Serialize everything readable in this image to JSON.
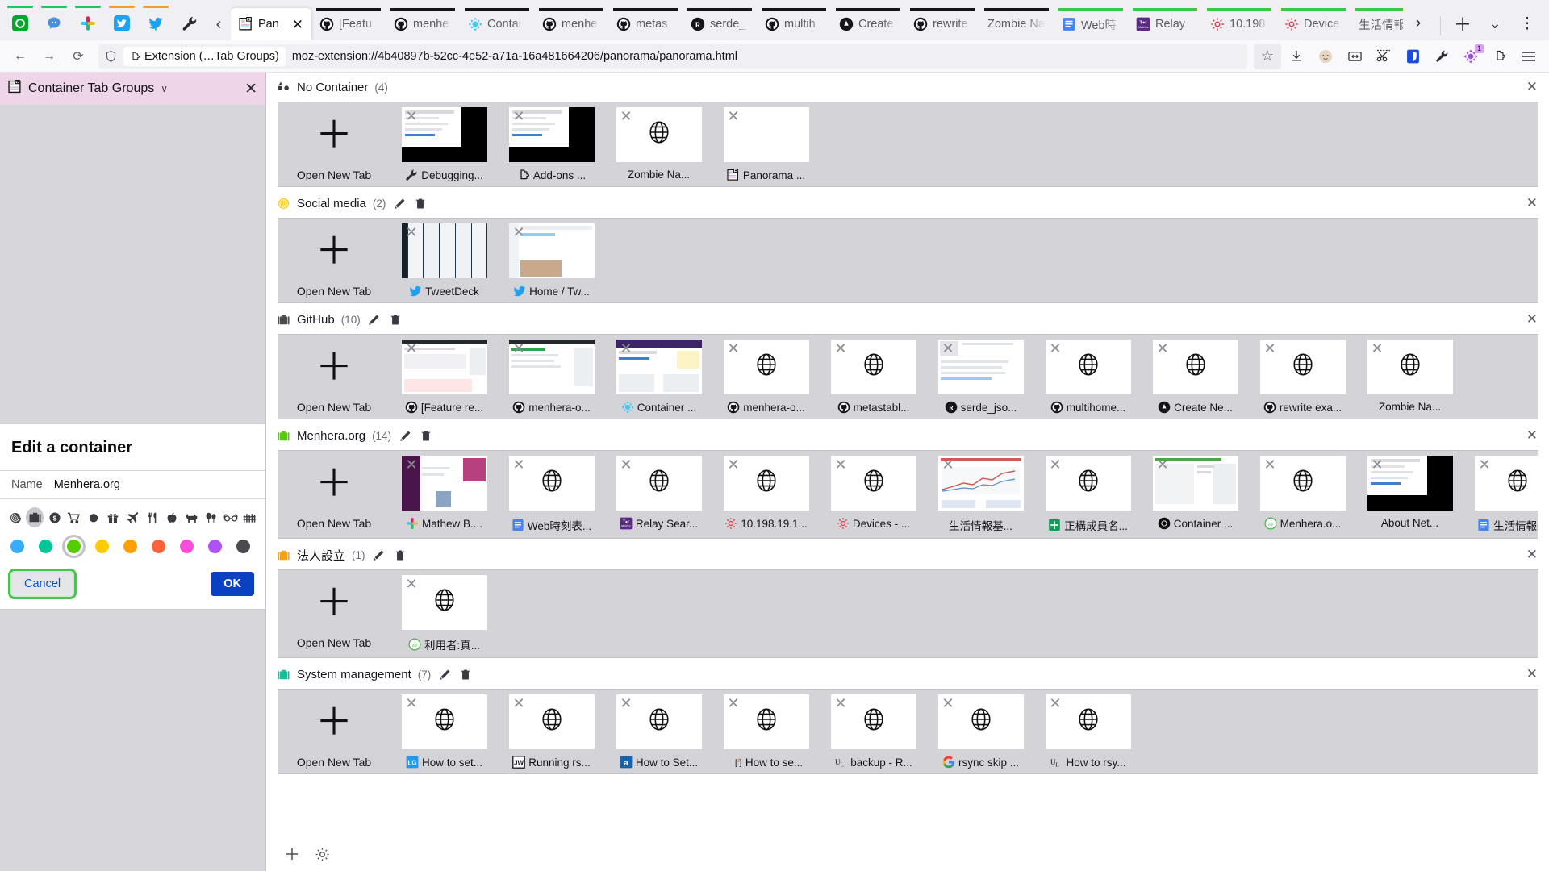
{
  "browser": {
    "pinned_tabs": [
      {
        "name": "evernote",
        "color": "#00a82d",
        "glyph": "◔",
        "accent": "#1fc36b"
      },
      {
        "name": "chat",
        "color": "#4a90d9",
        "glyph": "●",
        "accent": "#1fc36b"
      },
      {
        "name": "slack",
        "color": "#e01e5a",
        "glyph": "✵",
        "accent": "#1fc36b"
      },
      {
        "name": "twitter",
        "color": "#1da1f2",
        "glyph": "✉",
        "accent": "#f0a030"
      },
      {
        "name": "tweetdeck",
        "color": "#1da1f2",
        "glyph": "✈",
        "accent": "#f0a030"
      },
      {
        "name": "wrench",
        "color": "#3a3a42",
        "glyph": "🔧",
        "accent": ""
      }
    ],
    "scroll_left_label": "‹",
    "scroll_right_label": "›",
    "tabs": [
      {
        "title": "Panorama",
        "short": "Pan",
        "favicon": "panorama-icon",
        "active": true,
        "accent": ""
      },
      {
        "title": "[Feature request]",
        "short": "[Featu",
        "favicon": "github-icon",
        "active": false,
        "accent": "#15141a"
      },
      {
        "title": "menhera-org",
        "short": "menhe",
        "favicon": "github-icon",
        "active": false,
        "accent": "#15141a"
      },
      {
        "title": "Container Tab Groups",
        "short": "Contai",
        "favicon": "containers-icon",
        "active": false,
        "accent": "#15141a"
      },
      {
        "title": "menhera-org",
        "short": "menhe",
        "favicon": "github-icon",
        "active": false,
        "accent": "#15141a"
      },
      {
        "title": "metastable",
        "short": "metas",
        "favicon": "github-icon",
        "active": false,
        "accent": "#15141a"
      },
      {
        "title": "serde_json",
        "short": "serde_",
        "favicon": "rust-icon",
        "active": false,
        "accent": "#15141a"
      },
      {
        "title": "multihome",
        "short": "multih",
        "favicon": "github-icon",
        "active": false,
        "accent": "#15141a"
      },
      {
        "title": "Create New",
        "short": "Create",
        "favicon": "ghost-icon",
        "active": false,
        "accent": "#15141a"
      },
      {
        "title": "rewrite example",
        "short": "rewrite",
        "favicon": "github-icon",
        "active": false,
        "accent": "#15141a"
      },
      {
        "title": "Zombie Na",
        "short": "Zombie Na",
        "favicon": "none-icon",
        "active": false,
        "accent": "#15141a"
      },
      {
        "title": "Web時刻表",
        "short": "Web時",
        "favicon": "docs-icon",
        "active": false,
        "accent": "#3ac940"
      },
      {
        "title": "Relay Search",
        "short": "Relay",
        "favicon": "metrics-icon",
        "active": false,
        "accent": "#3ac940"
      },
      {
        "title": "10.198.19.1",
        "short": "10.198",
        "favicon": "router-icon",
        "active": false,
        "accent": "#3ac940"
      },
      {
        "title": "Devices",
        "short": "Device",
        "favicon": "router-icon",
        "active": false,
        "accent": "#3ac940"
      },
      {
        "title": "生活情報基",
        "short": "生活情報基",
        "favicon": "none-icon",
        "active": false,
        "accent": "#3ac940"
      },
      {
        "title": "正構成",
        "short": "正構成",
        "favicon": "sheets-icon",
        "active": false,
        "accent": "#3ac940"
      },
      {
        "title": "Container",
        "short": "Contai",
        "favicon": "blackcircle-icon",
        "active": false,
        "accent": "#3ac940"
      },
      {
        "title": "Menhera.org",
        "short": "Menhe",
        "favicon": "mastodon-icon",
        "active": false,
        "accent": "#3ac940"
      },
      {
        "title": "About Net",
        "short": "About N",
        "favicon": "none-icon",
        "active": false,
        "accent": "#3ac940"
      }
    ],
    "tabstrip_buttons": [
      {
        "name": "list-all-tabs-chevron",
        "glyph": "›"
      },
      {
        "name": "new-tab-button",
        "glyph": "＋"
      },
      {
        "name": "all-tabs-dropdown",
        "glyph": "⌄"
      },
      {
        "name": "app-menu-vertical",
        "glyph": "⋮"
      }
    ],
    "nav": {
      "back": "←",
      "forward": "→",
      "reload": "⟳",
      "shield": "shield-icon",
      "chip_label": "Extension (…Tab Groups)",
      "url": "moz-extension://4b40897b-52cc-4e52-a71a-16a481664206/panorama/panorama.html",
      "right_icons": [
        {
          "name": "bookmark-star-icon",
          "glyph": "☆"
        },
        {
          "name": "downloads-icon",
          "glyph": "⤓"
        },
        {
          "name": "account-avatar-icon",
          "glyph": "●"
        },
        {
          "name": "container-extension-icon",
          "glyph": "⬌"
        },
        {
          "name": "scissors-extension-icon",
          "glyph": "✂"
        },
        {
          "name": "bitwarden-icon",
          "glyph": "⛉"
        },
        {
          "name": "devtools-wrench-icon",
          "glyph": "🔧"
        },
        {
          "name": "containers-badge-icon",
          "glyph": "✻",
          "badge": "1"
        },
        {
          "name": "extension-puzzle-icon",
          "glyph": "🧩"
        },
        {
          "name": "hamburger-menu-icon",
          "glyph": "≡"
        }
      ]
    }
  },
  "sidebar": {
    "icon": "panorama-icon",
    "title": "Container Tab Groups",
    "caret": "∨",
    "close": "✕",
    "dialog": {
      "title": "Edit a container",
      "name_label": "Name",
      "name_value": "Menhera.org",
      "name_placeholder": "Name",
      "icons": [
        {
          "name": "fingerprint-icon",
          "glyph": "@",
          "selected": false
        },
        {
          "name": "briefcase-icon",
          "glyph": "▮",
          "selected": true
        },
        {
          "name": "dollar-icon",
          "glyph": "$",
          "selected": false
        },
        {
          "name": "cart-icon",
          "glyph": "⛟",
          "selected": false
        },
        {
          "name": "circle-icon",
          "glyph": "●",
          "selected": false
        },
        {
          "name": "gift-icon",
          "glyph": "☒",
          "selected": false
        },
        {
          "name": "vacation-plane-icon",
          "glyph": "✈",
          "selected": false
        },
        {
          "name": "food-fork-icon",
          "glyph": "⚔",
          "selected": false
        },
        {
          "name": "fruit-icon",
          "glyph": "●",
          "selected": false
        },
        {
          "name": "pet-dog-icon",
          "glyph": "❄",
          "selected": false
        },
        {
          "name": "tree-icon",
          "glyph": "♣",
          "selected": false
        },
        {
          "name": "chill-glasses-icon",
          "glyph": "∞",
          "selected": false
        },
        {
          "name": "fence-icon",
          "glyph": "╦",
          "selected": false
        }
      ],
      "colors": [
        {
          "name": "blue",
          "hex": "#37adff",
          "selected": false
        },
        {
          "name": "turquoise",
          "hex": "#00c79a",
          "selected": false
        },
        {
          "name": "green",
          "hex": "#51cd00",
          "selected": true
        },
        {
          "name": "yellow",
          "hex": "#ffcb00",
          "selected": false
        },
        {
          "name": "orange",
          "hex": "#ff9f00",
          "selected": false
        },
        {
          "name": "red",
          "hex": "#ff613d",
          "selected": false
        },
        {
          "name": "pink",
          "hex": "#ff4bda",
          "selected": false
        },
        {
          "name": "purple",
          "hex": "#af51f5",
          "selected": false
        },
        {
          "name": "toolbar",
          "hex": "#4a4a4f",
          "selected": false
        }
      ],
      "cancel_label": "Cancel",
      "ok_label": "OK"
    }
  },
  "panorama": {
    "new_tab_label": "Open New Tab",
    "plus_glyph": "＋",
    "close_glyph": "✕",
    "edit_glyph": "✎",
    "delete_glyph": "🗑",
    "globe_glyph": "⊕",
    "footer": [
      {
        "name": "add-group-button",
        "glyph": "＋"
      },
      {
        "name": "settings-gear-button",
        "glyph": "⚙"
      }
    ],
    "groups": [
      {
        "name": "No Container",
        "count": "(4)",
        "icon": "no-container-icon",
        "icon_color": "#3a3a42",
        "editable": false,
        "tabs": [
          {
            "title": "Debugging...",
            "favicon": "wrench-icon",
            "thumb": "screenshot-dark"
          },
          {
            "title": "Add-ons ...",
            "favicon": "puzzle-icon",
            "thumb": "screenshot-dark"
          },
          {
            "title": "Zombie Na...",
            "favicon": "none-icon",
            "thumb": "globe"
          },
          {
            "title": "Panorama ...",
            "favicon": "panorama-icon",
            "thumb": "blank"
          }
        ]
      },
      {
        "name": "Social media",
        "count": "(2)",
        "icon": "fingerprint-icon",
        "icon_color": "#ffcb00",
        "editable": true,
        "tabs": [
          {
            "title": "TweetDeck",
            "favicon": "twitter-icon",
            "thumb": "screenshot-tweetdeck"
          },
          {
            "title": "Home / Tw...",
            "favicon": "twitter-icon",
            "thumb": "screenshot-twitter"
          }
        ]
      },
      {
        "name": "GitHub",
        "count": "(10)",
        "icon": "briefcase-icon",
        "icon_color": "#4a4a4f",
        "editable": true,
        "tabs": [
          {
            "title": "[Feature re...",
            "favicon": "github-icon",
            "thumb": "screenshot-gh1"
          },
          {
            "title": "menhera-o...",
            "favicon": "github-icon",
            "thumb": "screenshot-gh2"
          },
          {
            "title": "Container ...",
            "favicon": "containers-icon",
            "thumb": "screenshot-gh3"
          },
          {
            "title": "menhera-o...",
            "favicon": "github-icon",
            "thumb": "globe"
          },
          {
            "title": "metastabl...",
            "favicon": "github-icon",
            "thumb": "globe"
          },
          {
            "title": "serde_jso...",
            "favicon": "rust-icon",
            "thumb": "screenshot-gh4"
          },
          {
            "title": "multihome...",
            "favicon": "github-icon",
            "thumb": "globe"
          },
          {
            "title": "Create Ne...",
            "favicon": "ghost-icon",
            "thumb": "globe"
          },
          {
            "title": "rewrite exa...",
            "favicon": "github-icon",
            "thumb": "globe"
          },
          {
            "title": "Zombie Na...",
            "favicon": "none-icon",
            "thumb": "globe"
          }
        ]
      },
      {
        "name": "Menhera.org",
        "count": "(14)",
        "icon": "briefcase-icon",
        "icon_color": "#51cd00",
        "editable": true,
        "tabs": [
          {
            "title": "Mathew B....",
            "favicon": "slack-icon",
            "thumb": "screenshot-slack"
          },
          {
            "title": "Web時刻表...",
            "favicon": "docs-icon",
            "thumb": "globe"
          },
          {
            "title": "Relay Sear...",
            "favicon": "metrics-icon",
            "thumb": "globe"
          },
          {
            "title": "10.198.19.1...",
            "favicon": "router-icon",
            "thumb": "globe"
          },
          {
            "title": "Devices - ...",
            "favicon": "router-icon",
            "thumb": "globe"
          },
          {
            "title": "生活情報基...",
            "favicon": "none-icon",
            "thumb": "screenshot-chart"
          },
          {
            "title": "正構成員名...",
            "favicon": "sheets-icon",
            "thumb": "globe"
          },
          {
            "title": "Container ...",
            "favicon": "blackcircle-icon",
            "thumb": "screenshot-doc"
          },
          {
            "title": "Menhera.o...",
            "favicon": "mastodon-icon",
            "thumb": "globe"
          },
          {
            "title": "About Net...",
            "favicon": "none-icon",
            "thumb": "screenshot-dark"
          },
          {
            "title": "生活情報基...",
            "favicon": "docs-icon",
            "thumb": "globe"
          }
        ]
      },
      {
        "name": "法人設立",
        "count": "(1)",
        "icon": "briefcase-icon",
        "icon_color": "#ff9f00",
        "editable": true,
        "tabs": [
          {
            "title": "利用者:真...",
            "favicon": "mastodon-icon",
            "thumb": "globe"
          }
        ]
      },
      {
        "name": "System management",
        "count": "(7)",
        "icon": "briefcase-icon",
        "icon_color": "#00c79a",
        "editable": true,
        "tabs": [
          {
            "title": "How to set...",
            "favicon": "linode-icon",
            "thumb": "globe"
          },
          {
            "title": "Running rs...",
            "favicon": "jw-icon",
            "thumb": "globe"
          },
          {
            "title": "How to Set...",
            "favicon": "answers-icon",
            "thumb": "globe"
          },
          {
            "title": "How to se...",
            "favicon": "smiley-icon",
            "thumb": "globe"
          },
          {
            "title": "backup - R...",
            "favicon": "ul-icon",
            "thumb": "globe"
          },
          {
            "title": "rsync skip ...",
            "favicon": "google-icon",
            "thumb": "globe"
          },
          {
            "title": "How to rsy...",
            "favicon": "ul-icon",
            "thumb": "globe"
          }
        ]
      }
    ]
  }
}
